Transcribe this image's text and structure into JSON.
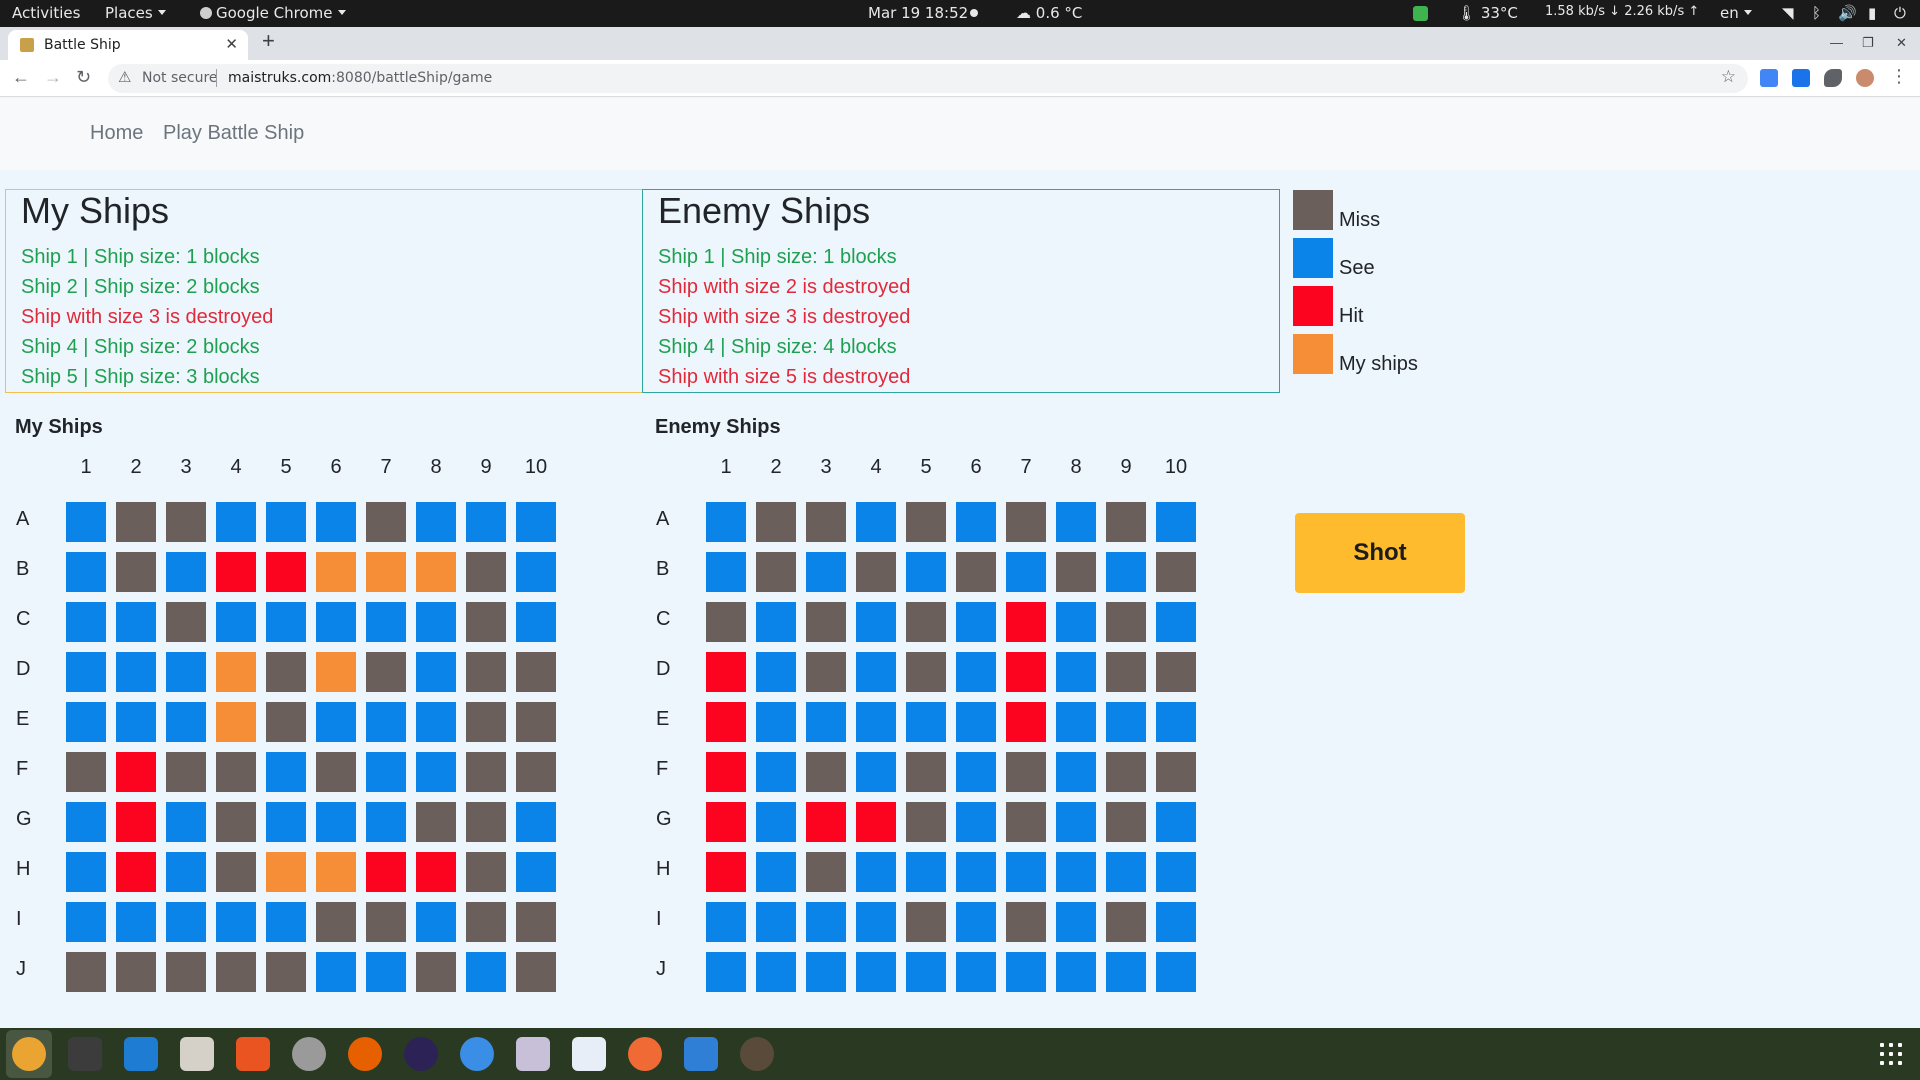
{
  "topbar": {
    "activities": "Activities",
    "places": "Places",
    "chrome": "Google Chrome",
    "datetime": "Mar 19  18:52",
    "weather": "0.6 °C",
    "temp": "33°C",
    "net_down": "1.58 kb/s",
    "net_up": "2.26 kb/s",
    "lang": "en"
  },
  "browser": {
    "tab_title": "Battle Ship",
    "not_secure": "Not secure",
    "url_host": "maistruks.com",
    "url_rest": ":8080/battleShip/game"
  },
  "nav": {
    "home": "Home",
    "play": "Play Battle Ship"
  },
  "my_status": {
    "title": "My Ships",
    "lines": [
      {
        "text": "Ship 1 | Ship size: 1 blocks",
        "state": "ok"
      },
      {
        "text": "Ship 2 | Ship size: 2 blocks",
        "state": "ok"
      },
      {
        "text": "Ship with size 3 is destroyed",
        "state": "bad"
      },
      {
        "text": "Ship 4 | Ship size: 2 blocks",
        "state": "ok"
      },
      {
        "text": "Ship 5 | Ship size: 3 blocks",
        "state": "ok"
      }
    ]
  },
  "enemy_status": {
    "title": "Enemy Ships",
    "lines": [
      {
        "text": "Ship 1 | Ship size: 1 blocks",
        "state": "ok"
      },
      {
        "text": "Ship with size 2 is destroyed",
        "state": "bad"
      },
      {
        "text": "Ship with size 3 is destroyed",
        "state": "bad"
      },
      {
        "text": "Ship 4 | Ship size: 4 blocks",
        "state": "ok"
      },
      {
        "text": "Ship with size 5 is destroyed",
        "state": "bad"
      }
    ]
  },
  "legend": [
    {
      "label": "Miss",
      "color": "#6b5f5b"
    },
    {
      "label": "See",
      "color": "#0b84ea"
    },
    {
      "label": "Hit",
      "color": "#fc0320"
    },
    {
      "label": "My ships",
      "color": "#f68d37"
    }
  ],
  "colors": {
    "m": "#6b5f5b",
    "s": "#0b84ea",
    "h": "#fc0320",
    "y": "#f68d37"
  },
  "board": {
    "cols": [
      "1",
      "2",
      "3",
      "4",
      "5",
      "6",
      "7",
      "8",
      "9",
      "10"
    ],
    "rows": [
      "A",
      "B",
      "C",
      "D",
      "E",
      "F",
      "G",
      "H",
      "I",
      "J"
    ]
  },
  "my_board": {
    "title": "My Ships",
    "grid": [
      "smmsssmsss",
      "smshhyyyms",
      "ssmsssssms",
      "sssymymsmm",
      "sssymsssm m",
      "mhmmsmssm m",
      "shsmsssmm s",
      "shsmyyhhm s",
      "sssssmmsm m",
      "mmmmmssmsm"
    ]
  },
  "enemy_board": {
    "title": "Enemy Ships",
    "grid": [
      "smmsmsmsms",
      "smsmsmsmsm",
      "msmsmshsms",
      "hsmsmshsmm",
      "hssssshsss",
      "hsmsmsmsmm",
      "hshhmsmsms",
      "hsmsssssss",
      "ssssmsmsms",
      "ssssssssss"
    ]
  },
  "shot_label": "Shot"
}
